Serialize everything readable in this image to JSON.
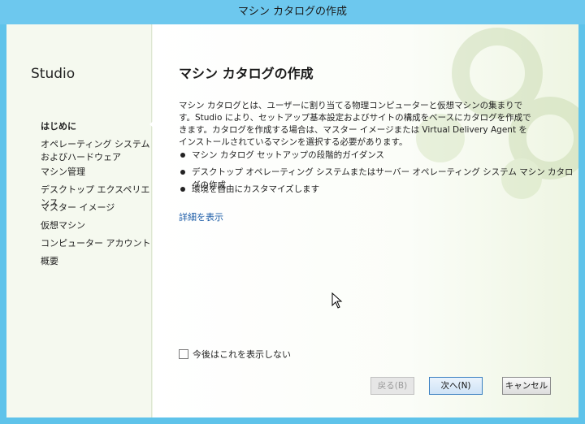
{
  "window": {
    "title": "マシン カタログの作成"
  },
  "sidebar": {
    "brand": "Studio",
    "items": [
      {
        "label": "はじめに",
        "label2": "",
        "active": true
      },
      {
        "label": "オペレーティング システム",
        "label2": "およびハードウェア",
        "active": false
      },
      {
        "label": "マシン管理",
        "label2": "",
        "active": false
      },
      {
        "label": "デスクトップ エクスペリエンス",
        "label2": "",
        "active": false
      },
      {
        "label": "マスター イメージ",
        "label2": "",
        "active": false
      },
      {
        "label": "仮想マシン",
        "label2": "",
        "active": false
      },
      {
        "label": "コンピューター アカウント",
        "label2": "",
        "active": false
      },
      {
        "label": "概要",
        "label2": "",
        "active": false
      }
    ]
  },
  "main": {
    "heading": "マシン カタログの作成",
    "description": "マシン カタログとは、ユーザーに割り当てる物理コンピューターと仮想マシンの集まりです。Studio により、セットアップ基本設定およびサイトの構成をベースにカタログを作成できます。カタログを作成する場合は、マスター イメージまたは Virtual Delivery Agent をインストールされているマシンを選択する必要があります。",
    "bullets": [
      "マシン カタログ セットアップの段階的ガイダンス",
      "デスクトップ オペレーティング システムまたはサーバー オペレーティング システム マシン カタログの作成",
      "環境を自由にカスタマイズします"
    ],
    "details_link": "詳細を表示",
    "dont_show_label": "今後はこれを表示しない",
    "dont_show_checked": false
  },
  "footer": {
    "back_label": "戻る(B)",
    "next_label": "次へ(N)",
    "cancel_label": "キャンセル"
  },
  "colors": {
    "titlebar": "#6dc8ee",
    "link": "#1f5ea8",
    "primary_border": "#3a7fc1"
  }
}
